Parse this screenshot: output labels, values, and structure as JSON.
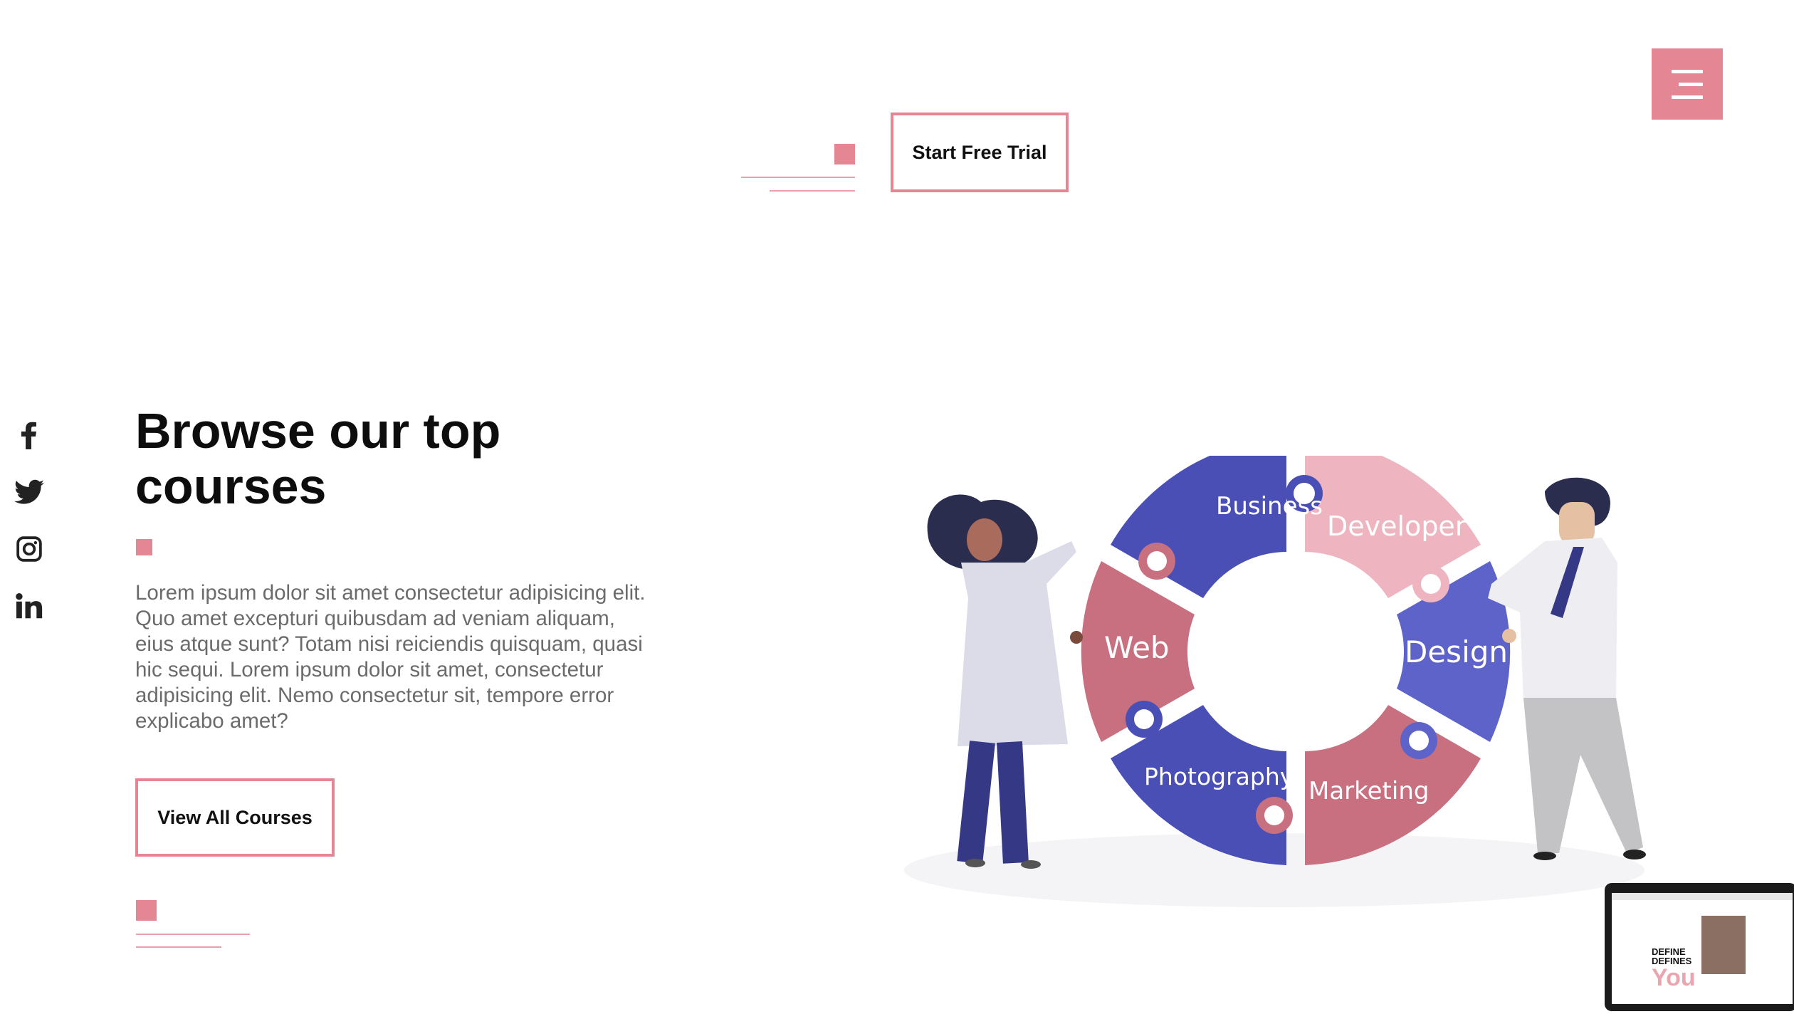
{
  "header": {
    "cta_label": "Start Free Trial",
    "menu_icon": "hamburger-icon"
  },
  "social": [
    {
      "name": "facebook",
      "icon": "facebook-icon"
    },
    {
      "name": "twitter",
      "icon": "twitter-icon"
    },
    {
      "name": "instagram",
      "icon": "instagram-icon"
    },
    {
      "name": "linkedin",
      "icon": "linkedin-icon"
    }
  ],
  "hero": {
    "title": "Browse our top courses",
    "description": "Lorem ipsum dolor sit amet consectetur adipisicing elit. Quo amet excepturi quibusdam ad veniam aliquam, eius atque sunt? Totam nisi reiciendis quisquam, quasi hic sequi. Lorem ipsum dolor sit amet, consectetur adipisicing elit. Nemo consectetur sit, tempore error explicabo amet?",
    "button_label": "View All Courses"
  },
  "illustration": {
    "categories": [
      "Business",
      "Developer",
      "Design",
      "Marketing",
      "Photography",
      "Web"
    ]
  },
  "thumbnail": {
    "line1": "DEFINE",
    "line2": "DEFINES",
    "line3": "You"
  },
  "colors": {
    "accent": "#e48693",
    "indigo": "#4a4fb5",
    "indigo_light": "#5d63c9",
    "rose": "#c97080",
    "pink_light": "#eeb5c0"
  }
}
